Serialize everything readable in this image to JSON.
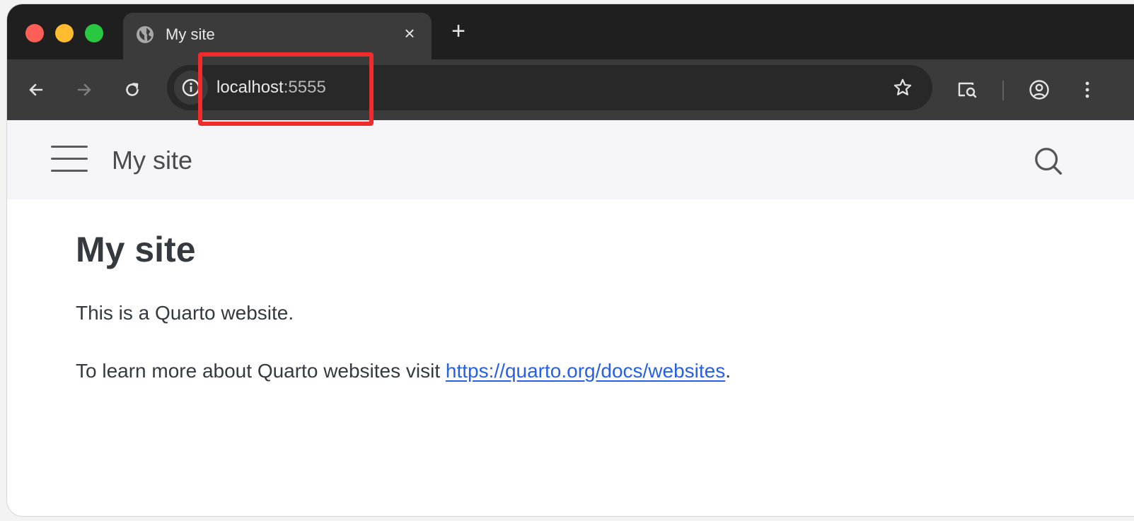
{
  "browser": {
    "tab": {
      "title": "My site",
      "close_label": "×"
    },
    "new_tab_label": "+",
    "address_bar": {
      "host": "localhost",
      "port": ":5555"
    },
    "icons": {
      "favicon": "globe-icon",
      "back": "arrow-left-icon",
      "forward": "arrow-right-icon",
      "reload": "reload-icon",
      "site_info": "info-icon",
      "bookmark": "star-icon",
      "lens": "search-page-icon",
      "profile": "profile-icon",
      "menu": "kebab-menu-icon"
    }
  },
  "site": {
    "navbar": {
      "brand": "My site",
      "menu_icon": "hamburger-icon",
      "search_icon": "search-icon"
    },
    "page": {
      "title": "My site",
      "intro": "This is a Quarto website.",
      "learn_more_prefix": "To learn more about Quarto websites visit ",
      "learn_more_link": "https://quarto.org/docs/websites",
      "learn_more_suffix": "."
    }
  },
  "colors": {
    "highlight": "#ef2b2b",
    "link": "#2761e3",
    "tabbar": "#1f1f1f",
    "toolbar": "#3b3b3b"
  }
}
